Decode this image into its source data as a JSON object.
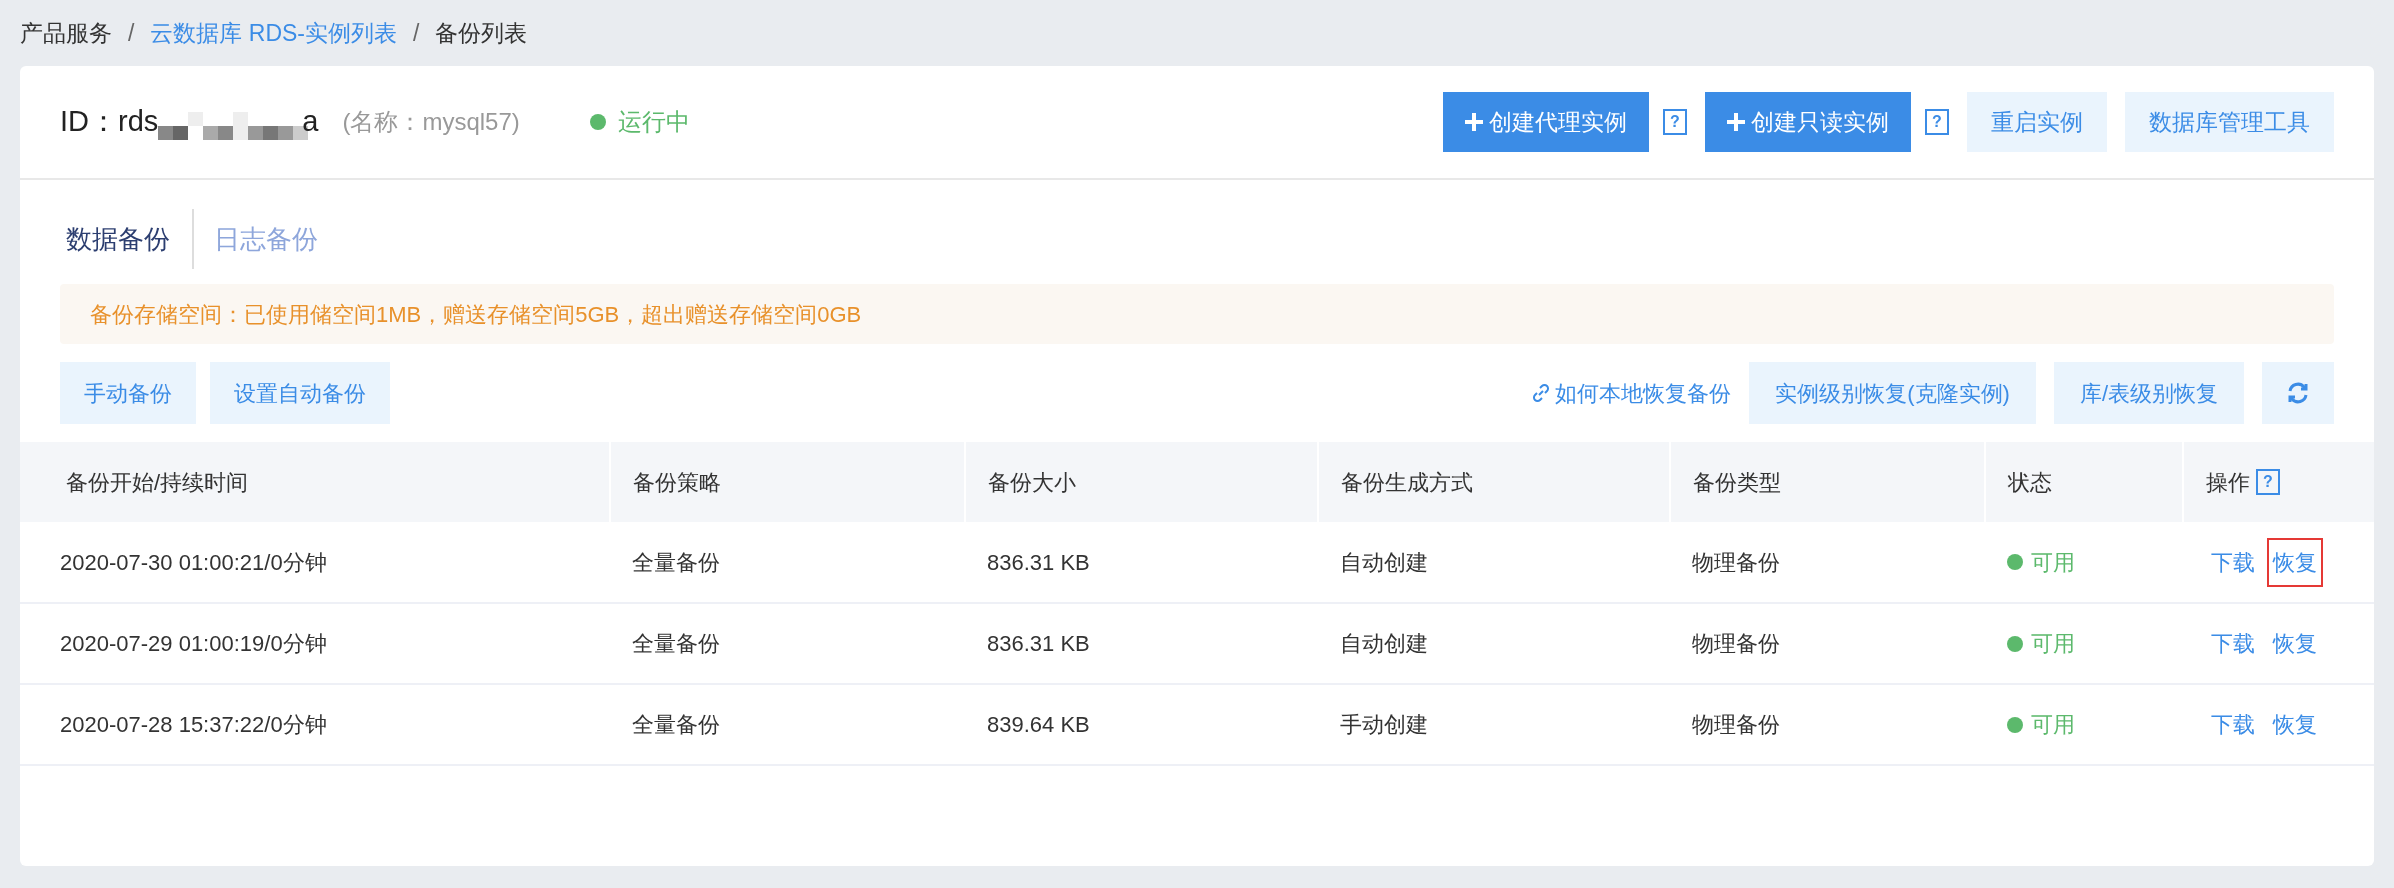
{
  "breadcrumb_separator": "/",
  "breadcrumb": [
    {
      "label": "产品服务",
      "link": false
    },
    {
      "label": "云数据库 RDS-实例列表",
      "link": true
    },
    {
      "label": "备份列表",
      "link": false
    }
  ],
  "instance": {
    "id_label": "ID：",
    "id_value": "rds",
    "id_tail": "a",
    "name": "(名称：mysql57)",
    "status": {
      "label": "运行中",
      "color": "#5cb96c"
    }
  },
  "header_actions": [
    {
      "kind": "primary",
      "label": "创建代理实例",
      "help": "?"
    },
    {
      "kind": "primary",
      "label": "创建只读实例",
      "help": "?"
    },
    {
      "kind": "secondary",
      "label": "重启实例"
    },
    {
      "kind": "secondary",
      "label": "数据库管理工具"
    }
  ],
  "tabs": [
    {
      "label": "数据备份",
      "selected": true
    },
    {
      "label": "日志备份",
      "selected": false
    }
  ],
  "notice": "备份存储空间：已使用储空间1MB，赠送存储空间5GB，超出赠送存储空间0GB",
  "toolbar_left": [
    "手动备份",
    "设置自动备份"
  ],
  "toolbar_link": "如何本地恢复备份",
  "toolbar_right": [
    "实例级别恢复(克隆实例)",
    "库/表级别恢复"
  ],
  "table": {
    "columns": [
      {
        "label": "备份开始/持续时间"
      },
      {
        "label": "备份策略"
      },
      {
        "label": "备份大小"
      },
      {
        "label": "备份生成方式"
      },
      {
        "label": "备份类型"
      },
      {
        "label": "状态"
      },
      {
        "label": "操作",
        "help": "?"
      }
    ],
    "rows": [
      {
        "time": "2020-07-30 01:00:21/0分钟",
        "policy": "全量备份",
        "size": "836.31 KB",
        "method": "自动创建",
        "type": "物理备份",
        "status": {
          "label": "可用",
          "color": "#5cb96c"
        },
        "actions": [
          {
            "label": "下载",
            "highlighted": false
          },
          {
            "label": "恢复",
            "highlighted": true
          }
        ]
      },
      {
        "time": "2020-07-29 01:00:19/0分钟",
        "policy": "全量备份",
        "size": "836.31 KB",
        "method": "自动创建",
        "type": "物理备份",
        "status": {
          "label": "可用",
          "color": "#5cb96c"
        },
        "actions": [
          {
            "label": "下载",
            "highlighted": false
          },
          {
            "label": "恢复",
            "highlighted": false
          }
        ]
      },
      {
        "time": "2020-07-28 15:37:22/0分钟",
        "policy": "全量备份",
        "size": "839.64 KB",
        "method": "手动创建",
        "type": "物理备份",
        "status": {
          "label": "可用",
          "color": "#5cb96c"
        },
        "actions": [
          {
            "label": "下载",
            "highlighted": false
          },
          {
            "label": "恢复",
            "highlighted": false
          }
        ]
      }
    ]
  }
}
